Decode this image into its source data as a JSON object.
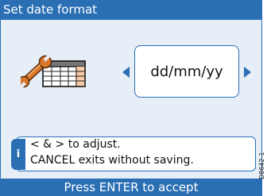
{
  "header": {
    "title": "Set date format"
  },
  "setting": {
    "value": "dd/mm/yy",
    "icon": "wrench-calendar-icon"
  },
  "info": {
    "icon_label": "i",
    "line1": "< & > to adjust.",
    "line2": "CANCEL exits without saving."
  },
  "footer": {
    "label": "Press ENTER to accept"
  },
  "reference_code": "D8642-1",
  "colors": {
    "accent": "#2a6fb4",
    "screen_bg": "#e6eef8",
    "box_bg": "#ffffff"
  }
}
